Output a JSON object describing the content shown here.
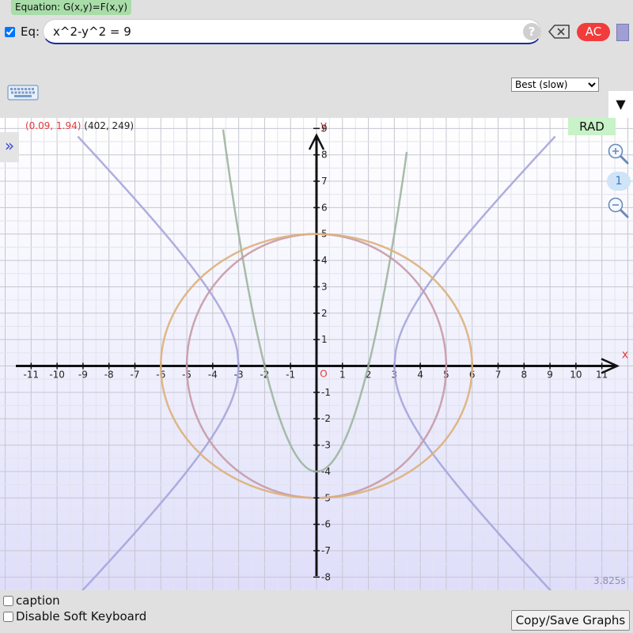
{
  "header": {
    "equation_label": "Equation: G(x,y)=F(x,y)",
    "eq_prefix": "Eq:",
    "eq_value": "x^2-y^2 = 9",
    "help_label": "?",
    "ac_label": "AC",
    "swatch_color": "#9f9fd6"
  },
  "toolbar": {
    "quality_selected": "Best (slow)",
    "menu_toggle": "▼"
  },
  "graph": {
    "coord_value": "(0.09, 1.94)",
    "coord_pixel": "(402, 249)",
    "expand_label": "»",
    "angle_mode": "RAD",
    "zoom_level": "1",
    "timing": "3.825s",
    "x_axis_label": "x",
    "y_axis_label": "y",
    "origin_label": "O"
  },
  "chart_data": {
    "type": "line",
    "x_range": [
      -12.2,
      12.2
    ],
    "y_range": [
      -8.5,
      9.4
    ],
    "x_ticks": [
      -11,
      -10,
      -9,
      -8,
      -7,
      -6,
      -5,
      -4,
      -3,
      -2,
      -1,
      1,
      2,
      3,
      4,
      5,
      6,
      7,
      8,
      9,
      10,
      11
    ],
    "y_ticks": [
      -8,
      -7,
      -6,
      -5,
      -4,
      -3,
      -2,
      -1,
      1,
      2,
      3,
      4,
      5,
      6,
      7,
      8,
      9
    ],
    "grid": true,
    "series": [
      {
        "kind": "hyperbola",
        "a": 3,
        "color": "#a5a5db",
        "x_extent": 9.2
      },
      {
        "kind": "parabola",
        "a": 1,
        "c": -4,
        "color": "#9fb59f",
        "x_span": [
          -3.6,
          3.5
        ]
      },
      {
        "kind": "circle",
        "r": 5,
        "color": "#c79aa7"
      },
      {
        "kind": "ellipse",
        "rx": 6,
        "ry": 5,
        "color": "#ddb07a"
      }
    ]
  },
  "footer": {
    "caption_label": "caption",
    "softkb_label": "Disable Soft Keyboard",
    "copy_label": "Copy/Save Graphs"
  }
}
